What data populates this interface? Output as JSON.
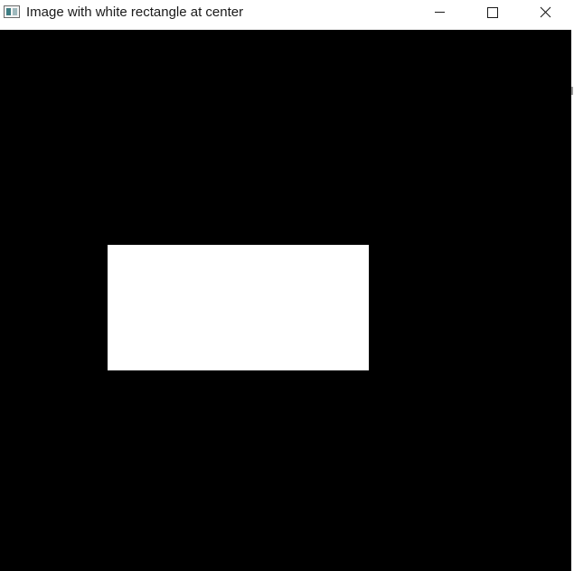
{
  "window": {
    "title": "Image with white rectangle at center",
    "app_icon": "image-viewer-icon",
    "controls": {
      "minimize_icon": "minimize-icon",
      "maximize_icon": "maximize-icon",
      "close_icon": "close-icon"
    }
  },
  "canvas": {
    "background_color": "#000000",
    "shape": {
      "kind": "rectangle",
      "fill_color": "#ffffff"
    }
  }
}
